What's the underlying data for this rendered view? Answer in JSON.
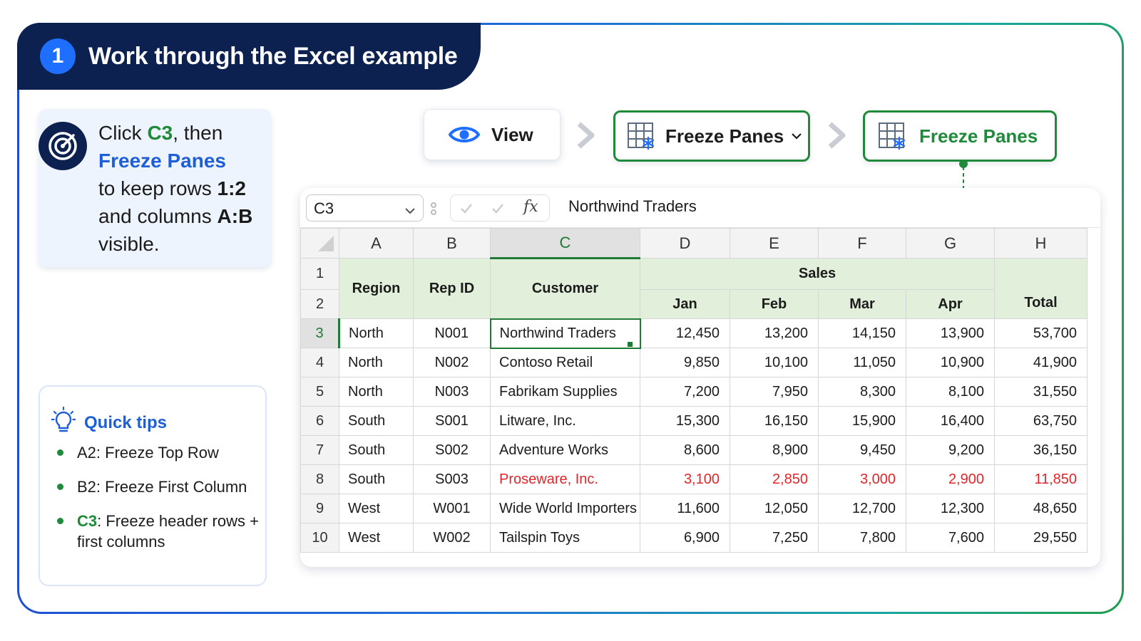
{
  "banner": {
    "step": "1",
    "title": "Work through the Excel example"
  },
  "instruction": {
    "p1": "Click ",
    "cell": "C3",
    "p2": ", then",
    "command": "Freeze Panes",
    "p3": "to keep rows ",
    "rows": "1:2",
    "p4": "and columns ",
    "cols": "A:B",
    "p5": "visible."
  },
  "ribbon": {
    "view_label": "View",
    "freeze_panes_menu_label": "Freeze Panes",
    "freeze_panes_option_label": "Freeze Panes"
  },
  "tips": {
    "title": "Quick tips",
    "items": [
      {
        "cell": "A2",
        "text": ": Freeze Top Row"
      },
      {
        "cell": "B2",
        "text": ": Freeze First Column"
      },
      {
        "cell": "C3",
        "text": ": Freeze header rows + first columns"
      }
    ]
  },
  "formula_bar": {
    "name_box": "C3",
    "fx": "fx",
    "formula": "Northwind Traders"
  },
  "sheet": {
    "columns": [
      "A",
      "B",
      "C",
      "D",
      "E",
      "F",
      "G",
      "H"
    ],
    "selected_column": "C",
    "selected_row": "3",
    "header": {
      "region": "Region",
      "rep_id": "Rep ID",
      "customer": "Customer",
      "sales": "Sales",
      "months": [
        "Jan",
        "Feb",
        "Mar",
        "Apr"
      ],
      "total": "Total"
    },
    "rows": [
      {
        "n": "3",
        "region": "North",
        "rep": "N001",
        "customer": "Northwind Traders",
        "jan": "12,450",
        "feb": "13,200",
        "mar": "14,150",
        "apr": "13,900",
        "total": "53,700"
      },
      {
        "n": "4",
        "region": "North",
        "rep": "N002",
        "customer": "Contoso Retail",
        "jan": "9,850",
        "feb": "10,100",
        "mar": "11,050",
        "apr": "10,900",
        "total": "41,900"
      },
      {
        "n": "5",
        "region": "North",
        "rep": "N003",
        "customer": "Fabrikam Supplies",
        "jan": "7,200",
        "feb": "7,950",
        "mar": "8,300",
        "apr": "8,100",
        "total": "31,550"
      },
      {
        "n": "6",
        "region": "South",
        "rep": "S001",
        "customer": "Litware, Inc.",
        "jan": "15,300",
        "feb": "16,150",
        "mar": "15,900",
        "apr": "16,400",
        "total": "63,750"
      },
      {
        "n": "7",
        "region": "South",
        "rep": "S002",
        "customer": "Adventure Works",
        "jan": "8,600",
        "feb": "8,900",
        "mar": "9,450",
        "apr": "9,200",
        "total": "36,150"
      },
      {
        "n": "8",
        "region": "South",
        "rep": "S003",
        "customer": "Proseware, Inc.",
        "jan": "3,100",
        "feb": "2,850",
        "mar": "3,000",
        "apr": "2,900",
        "total": "11,850",
        "highlight": true
      },
      {
        "n": "9",
        "region": "West",
        "rep": "W001",
        "customer": "Wide World Importers",
        "jan": "11,600",
        "feb": "12,050",
        "mar": "12,700",
        "apr": "12,300",
        "total": "48,650"
      },
      {
        "n": "10",
        "region": "West",
        "rep": "W002",
        "customer": "Tailspin Toys",
        "jan": "6,900",
        "feb": "7,250",
        "mar": "7,800",
        "apr": "7,600",
        "total": "29,550"
      }
    ]
  },
  "colors": {
    "accent_green": "#1e8a3a",
    "accent_blue": "#1e5fd8",
    "navy": "#0c2150",
    "header_fill": "#e2efda",
    "highlight_red": "#e0262b"
  }
}
